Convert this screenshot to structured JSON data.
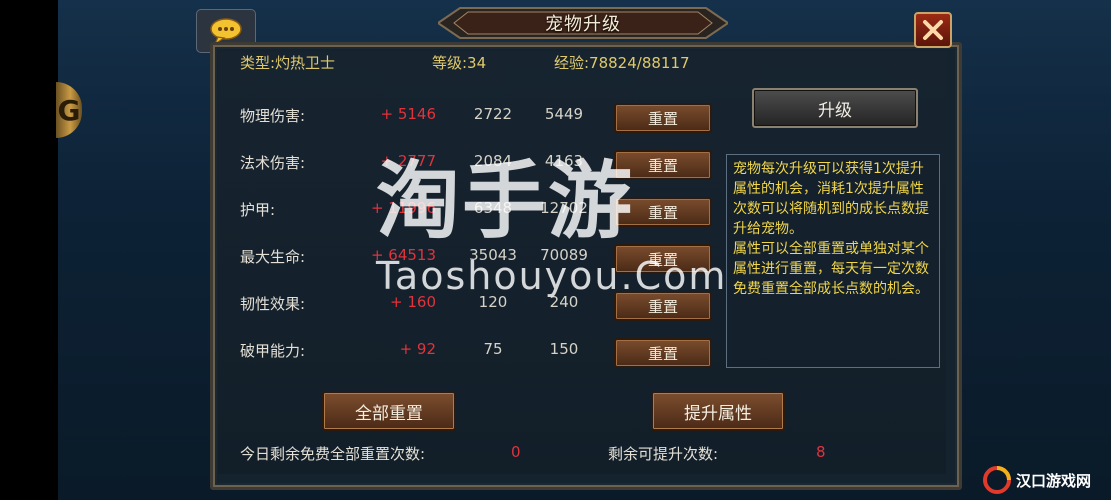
{
  "window": {
    "title": "宠物升级"
  },
  "pet": {
    "type_text": "类型:灼热卫士",
    "level_text": "等级:34",
    "exp_text": "经验:78824/88117"
  },
  "stats": [
    {
      "label": "物理伤害:",
      "bonus": "+ 5146",
      "current": "2722",
      "max": "5449",
      "reset_label": "重置"
    },
    {
      "label": "法术伤害:",
      "bonus": "+ 2777",
      "current": "2084",
      "max": "4163",
      "reset_label": "重置"
    },
    {
      "label": "护甲:",
      "bonus": "+ 11996",
      "current": "6348",
      "max": "12702",
      "reset_label": "重置"
    },
    {
      "label": "最大生命:",
      "bonus": "+ 64513",
      "current": "35043",
      "max": "70089",
      "reset_label": "重置"
    },
    {
      "label": "韧性效果:",
      "bonus": "+ 160",
      "current": "120",
      "max": "240",
      "reset_label": "重置"
    },
    {
      "label": "破甲能力:",
      "bonus": "+ 92",
      "current": "75",
      "max": "150",
      "reset_label": "重置"
    }
  ],
  "buttons": {
    "upgrade": "升级",
    "reset_all": "全部重置",
    "improve_attr": "提升属性"
  },
  "description": {
    "p1": "宠物每次升级可以获得1次提升属性的机会，消耗1次提升属性次数可以将随机到的成长点数提升给宠物。",
    "p2": "属性可以全部重置或单独对某个属性进行重置，每天有一定次数免费重置全部成长点数的机会。"
  },
  "footer": {
    "free_reset_label": "今日剩余免费全部重置次数:",
    "free_reset_value": "0",
    "remaining_label": "剩余可提升次数:",
    "remaining_value": "8"
  },
  "watermark": {
    "cn": "淘手游",
    "en": "Taoshouyou.Com"
  },
  "corner_logo": {
    "text": "汉口游戏网"
  },
  "colors": {
    "accent_gold": "#dfc96a",
    "bonus_red": "#e0333c",
    "desc_yellow": "#f0d64a"
  }
}
